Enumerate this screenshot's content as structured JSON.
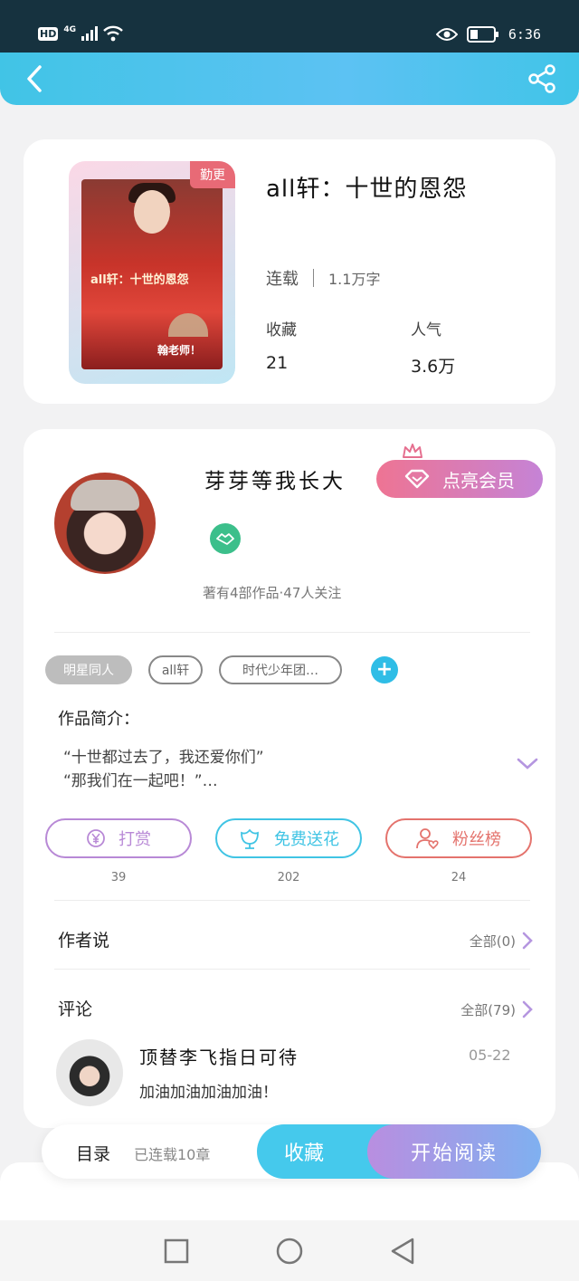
{
  "status_bar": {
    "hd": "HD",
    "network": "4G",
    "time": "6:36",
    "icons": [
      "signal-icon",
      "wifi-icon",
      "eye-icon",
      "battery-icon"
    ]
  },
  "nav": {
    "back_icon": "chevron-left-icon",
    "share_icon": "share-icon"
  },
  "book": {
    "cover_badge": "勤更",
    "cover_text": "all轩：十世的恩怨",
    "cover_signature": "翰老师！",
    "title": "all轩：十世的恩怨",
    "status": "连载",
    "word_count": "1.1万字",
    "favorites_label": "收藏",
    "favorites_value": "21",
    "popularity_label": "人气",
    "popularity_value": "3.6万"
  },
  "author": {
    "name": "芽芽等我长大",
    "vip_button": "点亮会员",
    "stats": "著有4部作品·47人关注"
  },
  "tags": [
    "明星同人",
    "all轩",
    "时代少年团…"
  ],
  "intro": {
    "label": "作品简介：",
    "line1": "“十世都过去了，我还爱你们”",
    "line2": "“那我们在一起吧！”…"
  },
  "actions": [
    {
      "label": "打赏",
      "count": "39",
      "color": "#b889d6"
    },
    {
      "label": "免费送花",
      "count": "202",
      "color": "#40c4e4"
    },
    {
      "label": "粉丝榜",
      "count": "24",
      "color": "#e4736d"
    }
  ],
  "author_says": {
    "title": "作者说",
    "link": "全部(0)"
  },
  "comments": {
    "title": "评论",
    "link": "全部(79)",
    "first": {
      "user": "顶替李飞指日可待",
      "date": "05-22",
      "text": "加油加油加油加油！"
    }
  },
  "bottom_bar": {
    "toc_label": "目录",
    "toc_status": "已连载10章",
    "favorite_button": "收藏",
    "read_button": "开始阅读"
  },
  "colors": {
    "header_gradient_start": "#41c4e6",
    "header_gradient_end": "#5cc2f3",
    "accent_blue": "#45c9ec",
    "vip_pink": "#ee7493",
    "vip_purple": "#c583d6"
  }
}
